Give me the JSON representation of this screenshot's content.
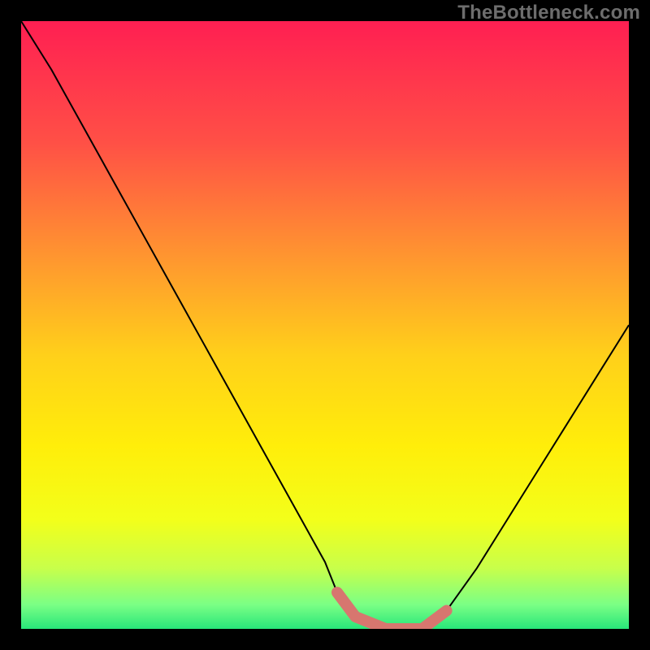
{
  "watermark": "TheBottleneck.com",
  "chart_data": {
    "type": "line",
    "x": [
      0,
      5,
      10,
      15,
      20,
      25,
      30,
      35,
      40,
      45,
      50,
      52,
      55,
      60,
      63,
      66,
      70,
      75,
      80,
      85,
      90,
      95,
      100
    ],
    "y": [
      100,
      92,
      83,
      74,
      65,
      56,
      47,
      38,
      29,
      20,
      11,
      6,
      2,
      0,
      0,
      0,
      3,
      10,
      18,
      26,
      34,
      42,
      50
    ],
    "xlim": [
      0,
      100
    ],
    "ylim": [
      0,
      100
    ],
    "xlabel": "",
    "ylabel": "",
    "highlight": {
      "xrange": [
        52,
        70
      ],
      "color": "#d7766f"
    },
    "background": {
      "type": "vertical-gradient",
      "stops": [
        {
          "pos": 0.0,
          "color": "#ff1f52"
        },
        {
          "pos": 0.2,
          "color": "#ff5046"
        },
        {
          "pos": 0.4,
          "color": "#ff9a2e"
        },
        {
          "pos": 0.55,
          "color": "#ffd01a"
        },
        {
          "pos": 0.7,
          "color": "#ffee0a"
        },
        {
          "pos": 0.82,
          "color": "#f3ff1a"
        },
        {
          "pos": 0.9,
          "color": "#c8ff4a"
        },
        {
          "pos": 0.96,
          "color": "#7bff85"
        },
        {
          "pos": 1.0,
          "color": "#28e67a"
        }
      ]
    }
  }
}
